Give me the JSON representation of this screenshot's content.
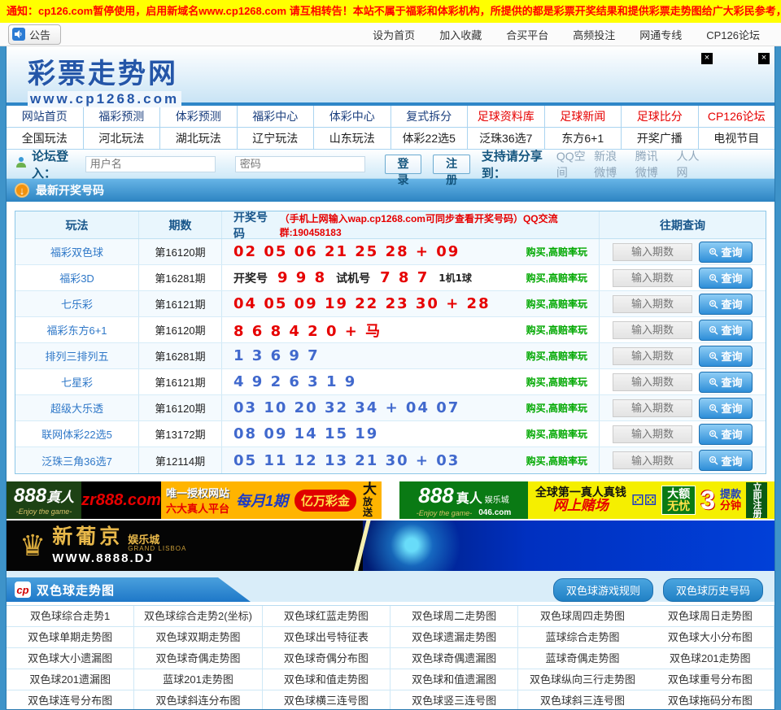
{
  "colors": {
    "accent_blue": "#2e86c8",
    "num_red": "#e60000",
    "num_blue": "#4169cd",
    "buy_green": "#00a800",
    "notice_bg": "#ffff00"
  },
  "notice": {
    "text": "通知：cp126.com暂停使用，启用新域名www.cp1268.com 请互相转告！本站不属于福彩和体彩机构，所提供的都是彩票开奖结果和提供彩票走势图给广大彩民参考，本站所有"
  },
  "topbar": {
    "announce": "公告",
    "links": [
      "设为首页",
      "加入收藏",
      "合买平台",
      "高频投注",
      "网通专线",
      "CP126论坛"
    ]
  },
  "header": {
    "close_icon": "×"
  },
  "logo": {
    "title": "彩票走势网",
    "url": "www.cp1268.com"
  },
  "nav": {
    "row1": [
      {
        "label": "网站首页",
        "cls": ""
      },
      {
        "label": "福彩预测",
        "cls": ""
      },
      {
        "label": "体彩预测",
        "cls": ""
      },
      {
        "label": "福彩中心",
        "cls": ""
      },
      {
        "label": "体彩中心",
        "cls": ""
      },
      {
        "label": "复式拆分",
        "cls": ""
      },
      {
        "label": "足球资料库",
        "cls": "red"
      },
      {
        "label": "足球新闻",
        "cls": "red"
      },
      {
        "label": "足球比分",
        "cls": "red"
      },
      {
        "label": "CP126论坛",
        "cls": "red"
      }
    ],
    "row2": [
      {
        "label": "全国玩法",
        "cls": ""
      },
      {
        "label": "河北玩法",
        "cls": ""
      },
      {
        "label": "湖北玩法",
        "cls": ""
      },
      {
        "label": "辽宁玩法",
        "cls": ""
      },
      {
        "label": "山东玩法",
        "cls": ""
      },
      {
        "label": "体彩22选5",
        "cls": ""
      },
      {
        "label": "泛珠36选7",
        "cls": ""
      },
      {
        "label": "东方6+1",
        "cls": ""
      },
      {
        "label": "开奖广播",
        "cls": ""
      },
      {
        "label": "电视节目",
        "cls": ""
      }
    ]
  },
  "login": {
    "label": "论坛登入：",
    "username_placeholder": "用户名",
    "password_placeholder": "密码",
    "login_btn": "登录",
    "register_btn": "注册",
    "share_label": "支持请分享到：",
    "share_links": [
      "QQ空间",
      "新浪微博",
      "腾讯微博",
      "人人网"
    ]
  },
  "latest": {
    "title": "最新开奖号码",
    "arrow": "↓"
  },
  "results": {
    "headers": {
      "game": "玩法",
      "issue": "期数",
      "numbers": "开奖号码",
      "numbers_note": "（手机上网输入wap.cp1268.com可同步查看开奖号码）QQ交流群:190458183",
      "history": "往期查询"
    },
    "buy_label": "购买,高赔率玩",
    "input_placeholder": "输入期数",
    "query_label": "查询",
    "rows": [
      {
        "game": "福彩双色球",
        "issue": "第16120期",
        "parts": [
          {
            "t": "02 05 06 21 25 28 + 09",
            "c": "red"
          }
        ]
      },
      {
        "game": "福彩3D",
        "issue": "第16281期",
        "parts": [
          {
            "t": "开奖号",
            "c": "label"
          },
          {
            "t": "9 9 8",
            "c": "red"
          },
          {
            "t": "试机号",
            "c": "label"
          },
          {
            "t": "7 8 7",
            "c": "red"
          },
          {
            "t": "1机1球",
            "c": "small"
          }
        ]
      },
      {
        "game": "七乐彩",
        "issue": "第16121期",
        "parts": [
          {
            "t": "04 05 09 19 22 23 30 + 28",
            "c": "red"
          }
        ]
      },
      {
        "game": "福彩东方6+1",
        "issue": "第16120期",
        "parts": [
          {
            "t": "8 6 8 4 2 0 + 马",
            "c": "red"
          }
        ]
      },
      {
        "game": "排列三排列五",
        "issue": "第16281期",
        "parts": [
          {
            "t": "1 3 6 9 7",
            "c": "blue"
          }
        ]
      },
      {
        "game": "七星彩",
        "issue": "第16121期",
        "parts": [
          {
            "t": "4 9 2 6 3 1 9",
            "c": "blue"
          }
        ]
      },
      {
        "game": "超级大乐透",
        "issue": "第16120期",
        "parts": [
          {
            "t": "03 10 20 32 34 + 04 07",
            "c": "blue"
          }
        ]
      },
      {
        "game": "联网体彩22选5",
        "issue": "第13172期",
        "parts": [
          {
            "t": "08 09 14 15 19",
            "c": "blue"
          }
        ]
      },
      {
        "game": "泛珠三角36选7",
        "issue": "第12114期",
        "parts": [
          {
            "t": "05 11 12 13 21 30 + 03",
            "c": "blue"
          }
        ]
      }
    ]
  },
  "ads": {
    "zr888": {
      "brand": "888",
      "brand2": "真人",
      "script": "-Enjoy the game-",
      "domain": "zr888.com",
      "line1": "唯一授权网站",
      "line2": "六大真人平台",
      "offer": "每月1期",
      "prize": "亿万彩金",
      "extra1": "大",
      "extra2": "放送"
    },
    "a046": {
      "brand": "888",
      "brand2": "真人",
      "sub": "娱乐城",
      "script": "-Enjoy the game-",
      "domain": "046.com",
      "line1": "全球第一真人真钱",
      "line2": "网上赌场",
      "dice": "⚂⚄",
      "box1": "大额",
      "box2": "无忧",
      "big": "3",
      "t1": "提款",
      "t2": "分钟",
      "register": "立即注册"
    },
    "lisboa": {
      "icon": "♛",
      "name": "新葡京",
      "sub": "娱乐城",
      "eng": "GRAND LISBOA",
      "url": "WWW.8888.DJ"
    }
  },
  "charts": {
    "title": "双色球走势图",
    "logo": "cp",
    "buttons": [
      "双色球游戏规则",
      "双色球历史号码"
    ],
    "links": [
      "双色球综合走势1",
      "双色球综合走势2(坐标)",
      "双色球红蓝走势图",
      "双色球周二走势图",
      "双色球周四走势图",
      "双色球周日走势图",
      "双色球单期走势图",
      "双色球双期走势图",
      "双色球出号特征表",
      "双色球遗漏走势图",
      "蓝球综合走势图",
      "双色球大小分布图",
      "双色球大小遗漏图",
      "双色球奇偶走势图",
      "双色球奇偶分布图",
      "双色球奇偶遗漏图",
      "蓝球奇偶走势图",
      "双色球201走势图",
      "双色球201遗漏图",
      "蓝球201走势图",
      "双色球和值走势图",
      "双色球和值遗漏图",
      "双色球纵向三行走势图",
      "双色球重号分布图",
      "双色球连号分布图",
      "双色球斜连分布图",
      "双色球横三连号图",
      "双色球竖三连号图",
      "双色球斜三连号图",
      "双色球拖码分布图"
    ]
  }
}
